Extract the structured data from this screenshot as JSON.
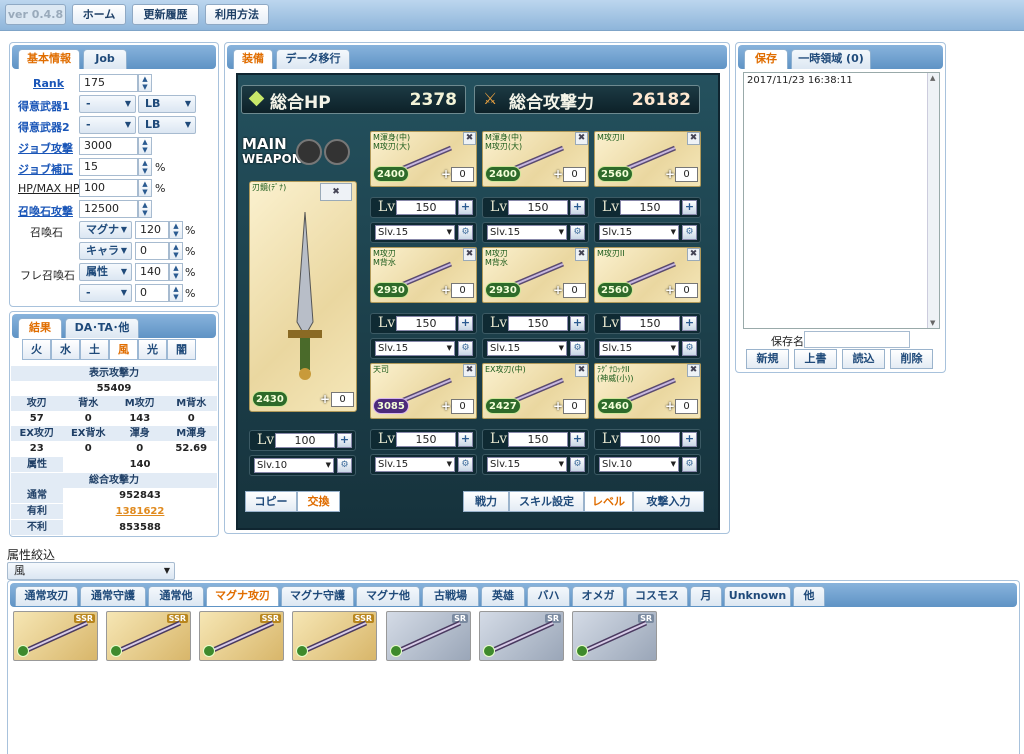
{
  "topnav": {
    "version": "ver 0.4.8",
    "home": "ホーム",
    "history": "更新履歴",
    "howto": "利用方法"
  },
  "left": {
    "tabs": [
      "基本情報",
      "Job"
    ],
    "rows": [
      {
        "label": "Rank",
        "value": "175"
      },
      {
        "label": "得意武器1",
        "sel1": "-",
        "sel2": "LB"
      },
      {
        "label": "得意武器2",
        "sel1": "-",
        "sel2": "LB"
      },
      {
        "label": "ジョブ攻撃",
        "value": "3000"
      },
      {
        "label": "ジョブ補正",
        "value": "15",
        "unit": "%"
      },
      {
        "label": "HP/MAX HP",
        "value": "100",
        "unit": "%"
      },
      {
        "label": "召喚石攻撃",
        "value": "12500"
      }
    ],
    "summon_label": "召喚石",
    "friend_label": "フレ召喚石",
    "summon_rows": [
      {
        "sel": "マグナ",
        "value": "120",
        "unit": "%"
      },
      {
        "sel": "キャラ",
        "value": "0",
        "unit": "%"
      },
      {
        "sel": "属性",
        "value": "140",
        "unit": "%"
      },
      {
        "sel": "-",
        "value": "0",
        "unit": "%"
      }
    ]
  },
  "result": {
    "tabs": [
      "結果",
      "DA･TA･他"
    ],
    "elements": [
      "火",
      "水",
      "土",
      "風",
      "光",
      "闇"
    ],
    "display_attack_label": "表示攻撃力",
    "display_attack": "55409",
    "row1_headers": [
      "攻刃",
      "背水",
      "M攻刃",
      "M背水"
    ],
    "row1_values": [
      "57",
      "0",
      "143",
      "0"
    ],
    "row2_headers": [
      "EX攻刃",
      "EX背水",
      "渾身",
      "M渾身"
    ],
    "row2_values": [
      "23",
      "0",
      "0",
      "52.69"
    ],
    "attr_label": "属性",
    "attr_value": "140",
    "total_label": "総合攻撃力",
    "totals": [
      {
        "label": "通常",
        "value": "952843",
        "color": "#222222"
      },
      {
        "label": "有利",
        "value": "1381622",
        "color": "#e08a1e"
      },
      {
        "label": "不利",
        "value": "853588",
        "color": "#222222"
      }
    ]
  },
  "center": {
    "tabs": [
      "装備",
      "データ移行"
    ],
    "hp_label": "総合HP",
    "hp_value": "2378",
    "atk_label": "総合攻撃力",
    "atk_value": "26182",
    "main_label": "MAIN",
    "main_sub": "WEAPON",
    "main": {
      "title": "刃鏡(ﾃﾞﾅ)",
      "atk": "2430",
      "plus": "0",
      "lv": "100",
      "slv": "Slv.10"
    },
    "grid": [
      {
        "title": "M渾身(中)\nM攻刃(大)",
        "atk": "2400",
        "plus": "0",
        "lv": "150",
        "slv": "Slv.15",
        "color": "#2e6a2a"
      },
      {
        "title": "M渾身(中)\nM攻刃(大)",
        "atk": "2400",
        "plus": "0",
        "lv": "150",
        "slv": "Slv.15",
        "color": "#2e6a2a"
      },
      {
        "title": "M攻刃II",
        "atk": "2560",
        "plus": "0",
        "lv": "150",
        "slv": "Slv.15",
        "color": "#2e6a2a"
      },
      {
        "title": "M攻刃\nM背水",
        "atk": "2930",
        "plus": "0",
        "lv": "150",
        "slv": "Slv.15",
        "color": "#2e6a2a"
      },
      {
        "title": "M攻刃\nM背水",
        "atk": "2930",
        "plus": "0",
        "lv": "150",
        "slv": "Slv.15",
        "color": "#2e6a2a"
      },
      {
        "title": "M攻刃II",
        "atk": "2560",
        "plus": "0",
        "lv": "150",
        "slv": "Slv.15",
        "color": "#2e6a2a"
      },
      {
        "title": "天司",
        "atk": "3085",
        "plus": "0",
        "lv": "150",
        "slv": "Slv.15",
        "color": "#4c2a7a"
      },
      {
        "title": "EX攻刃(中)",
        "atk": "2427",
        "plus": "0",
        "lv": "150",
        "slv": "Slv.15",
        "color": "#2e6a2a"
      },
      {
        "title": "ﾗｸﾞﾅﾛｯｸII\n(神威(小))",
        "atk": "2460",
        "plus": "0",
        "lv": "100",
        "slv": "Slv.10",
        "color": "#2e6a2a"
      }
    ],
    "lv_label": "Lv",
    "copy": "コピー",
    "swap": "交換",
    "mode_buttons": [
      "戦力",
      "スキル設定",
      "レベル",
      "攻撃入力"
    ],
    "mode_active": 2
  },
  "save": {
    "tabs": [
      "保存",
      "一時領域 (0)"
    ],
    "entries": [
      "2017/11/23 16:38:11"
    ],
    "name_label": "保存名:",
    "name_value": "",
    "buttons": [
      "新規",
      "上書",
      "読込",
      "削除"
    ]
  },
  "filter": {
    "label": "属性絞込",
    "selected": "風",
    "tabs": [
      "通常攻刃",
      "通常守護",
      "通常他",
      "マグナ攻刃",
      "マグナ守護",
      "マグナ他",
      "古戦場",
      "英雄",
      "バハ",
      "オメガ",
      "コスモス",
      "月",
      "Unknown",
      "他"
    ],
    "active": 3,
    "items": [
      {
        "rarity": "SSR"
      },
      {
        "rarity": "SSR"
      },
      {
        "rarity": "SSR"
      },
      {
        "rarity": "SSR"
      },
      {
        "rarity": "SR"
      },
      {
        "rarity": "SR"
      },
      {
        "rarity": "SR"
      }
    ]
  }
}
